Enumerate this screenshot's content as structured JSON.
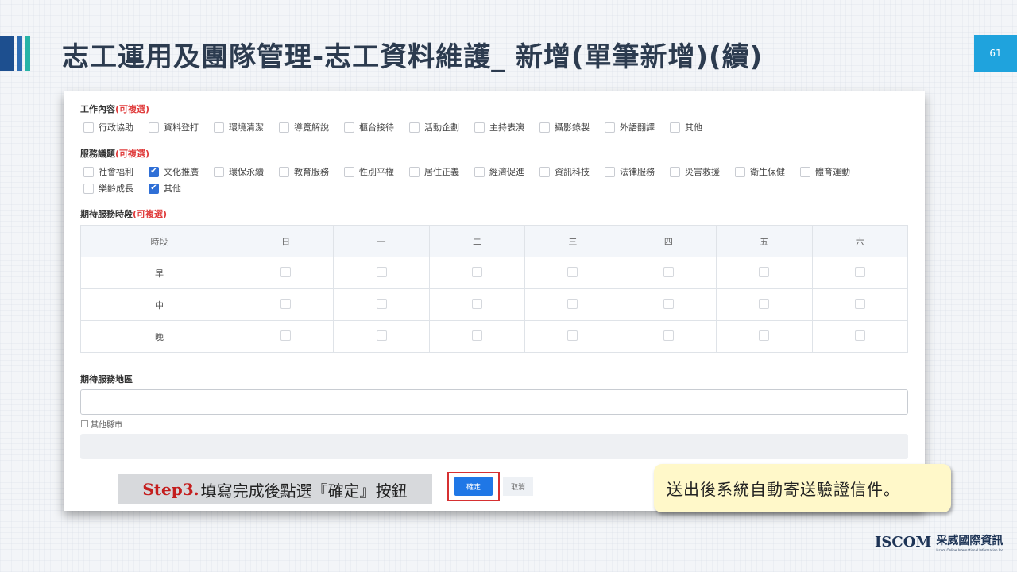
{
  "slide": {
    "title": "志工運用及團隊管理-志工資料維護_ 新增(單筆新增)(續)",
    "page_number": "61"
  },
  "form": {
    "work_content": {
      "label": "工作內容",
      "tag": "(可複選)",
      "options": [
        {
          "label": "行政協助",
          "checked": false
        },
        {
          "label": "資料登打",
          "checked": false
        },
        {
          "label": "環境清潔",
          "checked": false
        },
        {
          "label": "導覽解說",
          "checked": false
        },
        {
          "label": "櫃台接待",
          "checked": false
        },
        {
          "label": "活動企劃",
          "checked": false
        },
        {
          "label": "主持表演",
          "checked": false
        },
        {
          "label": "攝影錄製",
          "checked": false
        },
        {
          "label": "外語翻譯",
          "checked": false
        },
        {
          "label": "其他",
          "checked": false
        }
      ]
    },
    "service_topics": {
      "label": "服務議題",
      "tag": "(可複選)",
      "options": [
        {
          "label": "社會福利",
          "checked": false
        },
        {
          "label": "文化推廣",
          "checked": true
        },
        {
          "label": "環保永續",
          "checked": false
        },
        {
          "label": "教育服務",
          "checked": false
        },
        {
          "label": "性別平權",
          "checked": false
        },
        {
          "label": "居住正義",
          "checked": false
        },
        {
          "label": "經濟促進",
          "checked": false
        },
        {
          "label": "資訊科技",
          "checked": false
        },
        {
          "label": "法律服務",
          "checked": false
        },
        {
          "label": "災害救援",
          "checked": false
        },
        {
          "label": "衛生保健",
          "checked": false
        },
        {
          "label": "體育運動",
          "checked": false
        },
        {
          "label": "樂齡成長",
          "checked": false
        },
        {
          "label": "其他",
          "checked": true
        }
      ]
    },
    "service_period": {
      "label": "期待服務時段",
      "tag": "(可複選)",
      "header": [
        "時段",
        "日",
        "一",
        "二",
        "三",
        "四",
        "五",
        "六"
      ],
      "rows": [
        "早",
        "中",
        "晚"
      ]
    },
    "service_area": {
      "label": "期待服務地區",
      "input_value": "",
      "other_county_label": "其他縣市",
      "other_county_value": ""
    },
    "buttons": {
      "confirm": "確定",
      "cancel": "取消"
    }
  },
  "annotations": {
    "step_prefix": "Step3.",
    "step_text": "填寫完成後點選『確定』按鈕",
    "callout": "送出後系統自動寄送驗證信件。"
  },
  "logo": {
    "mark": "ISCOM",
    "name_zh": "采威國際資訊",
    "name_en": "Iscom Online International Information Inc."
  },
  "colors": {
    "accent_blue": "#1f77e6",
    "required_red": "#e03c3c",
    "highlight_frame": "#d63031",
    "callout_bg": "#fff8c9",
    "page_badge": "#1fa3dd"
  }
}
